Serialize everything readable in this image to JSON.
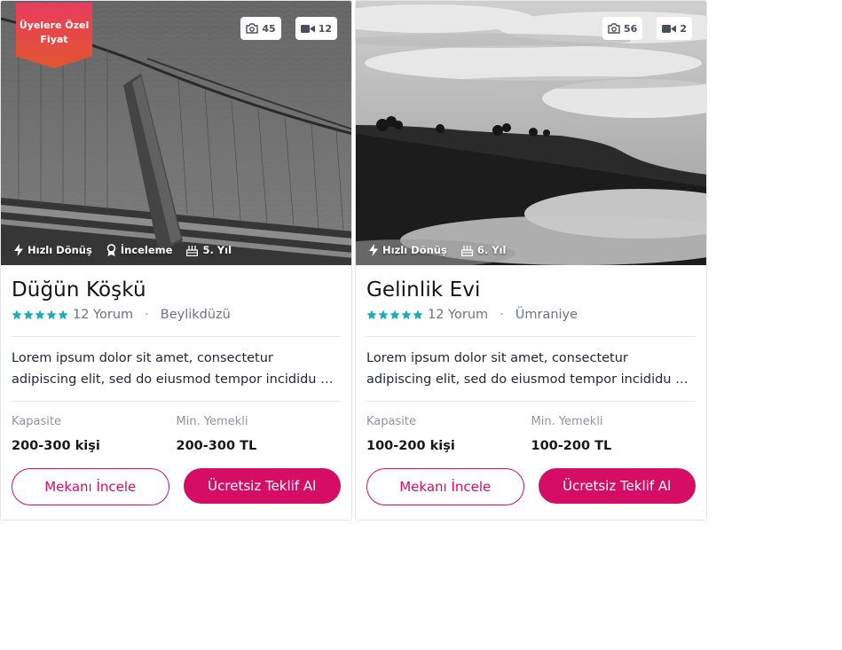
{
  "colors": {
    "brand": "#d60d66",
    "star": "#1aaeb4",
    "ribbon_top": "#ea3b5d",
    "ribbon_bottom": "#e0562f"
  },
  "cards": [
    {
      "ribbon": "Üyelere Özel Fiyat",
      "photo_counts": {
        "photos": "45",
        "videos": "12"
      },
      "features": [
        {
          "icon": "bolt-icon",
          "label": "Hızlı Dönüş"
        },
        {
          "icon": "award-icon",
          "label": "İnceleme"
        },
        {
          "icon": "cake-icon",
          "label": "5. Yıl"
        }
      ],
      "title": "Düğün Köşkü",
      "rating_stars": 5,
      "reviews": "12 Yorum",
      "location": "Beylikdüzü",
      "description": "Lorem ipsum dolor sit amet, consectetur adipiscing elit, sed do eiusmod tempor incididunt ut labore et dolore magna aliqua.",
      "capacity_label": "Kapasite",
      "capacity_value": "200-300 kişi",
      "price_label": "Min. Yemekli",
      "price_value": "200-300 TL",
      "btn_view": "Mekanı İncele",
      "btn_offer": "Ücretsiz Teklif Al"
    },
    {
      "ribbon": "",
      "photo_counts": {
        "photos": "56",
        "videos": "2"
      },
      "features": [
        {
          "icon": "bolt-icon",
          "label": "Hızlı Dönüş"
        },
        {
          "icon": "cake-icon",
          "label": "6. Yıl"
        }
      ],
      "title": "Gelinlik Evi",
      "rating_stars": 5,
      "reviews": "12 Yorum",
      "location": "Ümraniye",
      "description": "Lorem ipsum dolor sit amet, consectetur adipiscing elit, sed do eiusmod tempor incididunt ut labore et dolore magna aliqua.",
      "capacity_label": "Kapasite",
      "capacity_value": "100-200 kişi",
      "price_label": "Min. Yemekli",
      "price_value": "100-200 TL",
      "btn_view": "Mekanı İncele",
      "btn_offer": "Ücretsiz Teklif Al"
    }
  ]
}
